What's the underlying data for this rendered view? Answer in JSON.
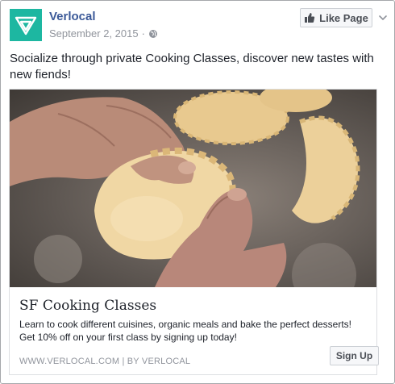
{
  "page": {
    "name": "Verlocal",
    "date": "September 2, 2015",
    "separator": "·",
    "logo_icon": "triangle-logo-icon",
    "privacy_icon": "globe-icon"
  },
  "actions": {
    "like_label": "Like Page",
    "like_icon": "thumbs-up-icon",
    "menu_icon": "chevron-down-icon"
  },
  "post": {
    "text": "Socialize through private Cooking Classes, discover new tastes with new fiends!"
  },
  "attachment": {
    "image": "hands-shaping-dumpling-photo",
    "title": "SF Cooking Classes",
    "description": "Learn to cook different cuisines, organic meals and bake the perfect desserts! Get 10% off on your first class by signing up today!",
    "source": "WWW.VERLOCAL.COM | BY VERLOCAL",
    "cta_label": "Sign Up"
  },
  "colors": {
    "brand_teal": "#1db7a1",
    "link_blue": "#3b5998",
    "meta_gray": "#90949c",
    "border": "#a5a7ab"
  }
}
